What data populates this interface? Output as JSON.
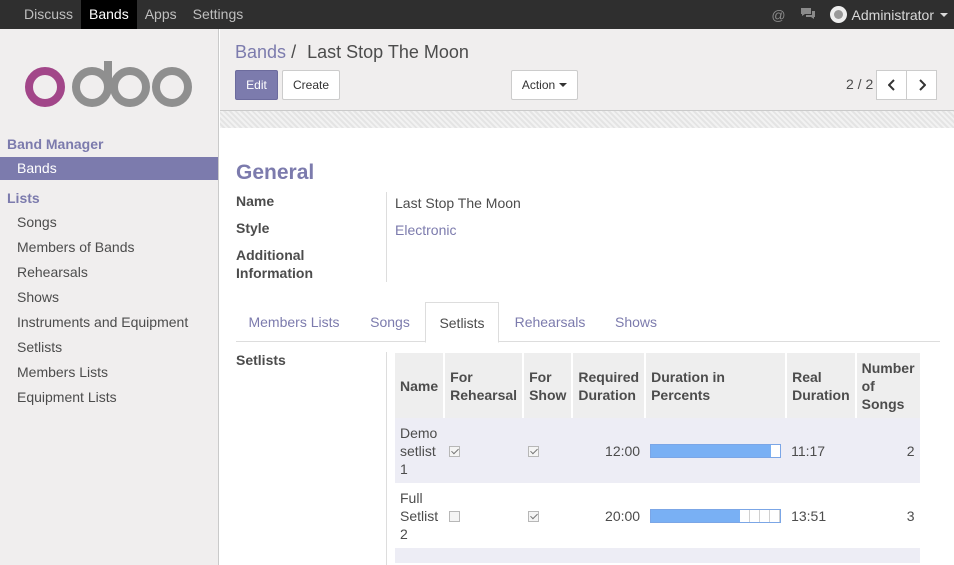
{
  "topbar": {
    "menu": [
      "Discuss",
      "Bands",
      "Apps",
      "Settings"
    ],
    "active_menu": "Bands",
    "icons": [
      "at-icon",
      "chat-icon"
    ],
    "user": "Administrator"
  },
  "sidebar": {
    "logo": "odoo",
    "section1": "Band Manager",
    "section1_items": [
      "Bands"
    ],
    "section2": "Lists",
    "section2_items": [
      "Songs",
      "Members of Bands",
      "Rehearsals",
      "Shows",
      "Instruments and Equipment",
      "Setlists",
      "Members Lists",
      "Equipment Lists"
    ]
  },
  "control_panel": {
    "breadcrumb_root": "Bands",
    "breadcrumb_sep": "/",
    "breadcrumb_current": "Last Stop The Moon",
    "edit_label": "Edit",
    "create_label": "Create",
    "action_label": "Action",
    "pager": "2 / 2"
  },
  "form": {
    "section_title": "General",
    "name_label": "Name",
    "name_value": "Last Stop The Moon",
    "style_label": "Style",
    "style_value": "Electronic",
    "additional_label_1": "Additional",
    "additional_label_2": "Information",
    "tabs": [
      "Members Lists",
      "Songs",
      "Setlists",
      "Rehearsals",
      "Shows"
    ],
    "active_tab": "Setlists",
    "setlists_label": "Setlists"
  },
  "setlists_table": {
    "headers": [
      "Name",
      "For Rehearsal",
      "For Show",
      "Required Duration",
      "Duration in Percents",
      "Real Duration",
      "Number of Songs"
    ],
    "rows": [
      {
        "name": "Demo setlist 1",
        "for_rehearsal": true,
        "for_show": true,
        "required": "12:00",
        "percent_fill": 0.93,
        "real": "11:17",
        "songs": "2"
      },
      {
        "name": "Full Setlist 2",
        "for_rehearsal": false,
        "for_show": true,
        "required": "20:00",
        "percent_fill": 0.69,
        "real": "13:51",
        "songs": "3"
      }
    ]
  },
  "colors": {
    "brand": "#7c7bad",
    "topbar": "#2f2f2f",
    "sidebar_bg": "#f0eeee",
    "bar_fill": "#79b0f4",
    "logo_o1": "#a24689",
    "logo_doo": "#8f8f8f"
  }
}
